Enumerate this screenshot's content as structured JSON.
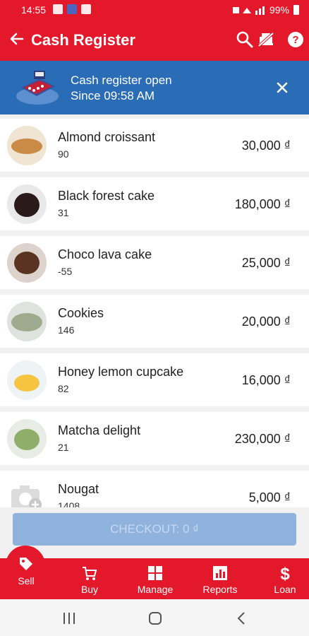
{
  "status": {
    "time": "14:55",
    "battery": "99%"
  },
  "header": {
    "title": "Cash Register"
  },
  "banner": {
    "line1": "Cash register open",
    "line2": "Since 09:58 AM"
  },
  "products": [
    {
      "name": "Almond croissant",
      "count": "90",
      "price": "30,000 ₫",
      "icon": "croissant-thumbnail"
    },
    {
      "name": "Black forest cake",
      "count": "31",
      "price": "180,000 ₫",
      "icon": "black-forest-cake-thumbnail"
    },
    {
      "name": "Choco lava cake",
      "count": "-55",
      "price": "25,000 ₫",
      "icon": "choco-lava-cake-thumbnail"
    },
    {
      "name": "Cookies",
      "count": "146",
      "price": "20,000 ₫",
      "icon": "cookies-thumbnail"
    },
    {
      "name": "Honey lemon cupcake",
      "count": "82",
      "price": "16,000 ₫",
      "icon": "cupcake-thumbnail"
    },
    {
      "name": "Matcha delight",
      "count": "21",
      "price": "230,000 ₫",
      "icon": "matcha-thumbnail"
    },
    {
      "name": "Nougat",
      "count": "1408",
      "price": "5,000 ₫",
      "icon": "camera-placeholder-icon"
    }
  ],
  "checkout": {
    "label": "CHECKOUT: 0 ₫"
  },
  "nav": [
    {
      "label": "Sell",
      "icon": "tag-icon"
    },
    {
      "label": "Buy",
      "icon": "cart-icon"
    },
    {
      "label": "Manage",
      "icon": "grid-icon"
    },
    {
      "label": "Reports",
      "icon": "chart-icon"
    },
    {
      "label": "Loan",
      "icon": "dollar-icon"
    }
  ],
  "colors": {
    "primary": "#e3182b",
    "banner": "#2b6cb6",
    "checkout_disabled": "#8fb3dc"
  }
}
